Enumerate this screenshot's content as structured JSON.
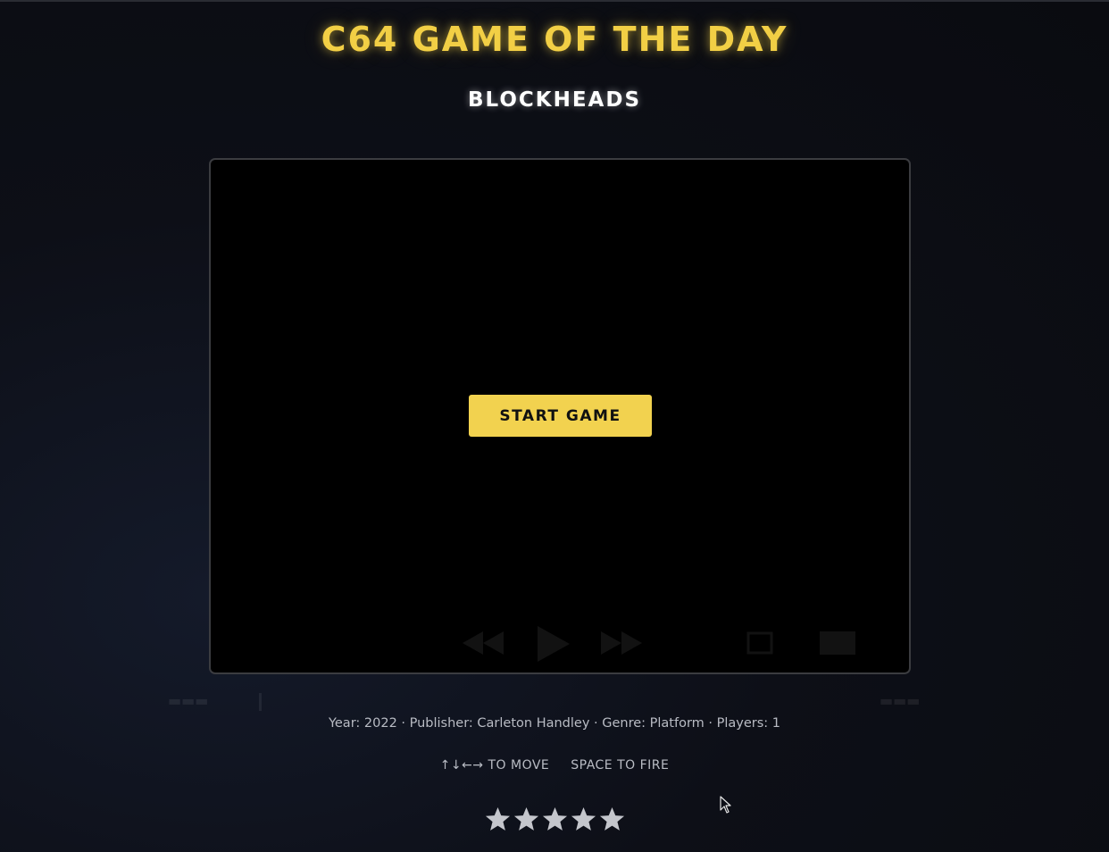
{
  "header": {
    "site_title": "C64 GAME OF THE DAY",
    "game_title": "BLOCKHEADS"
  },
  "player": {
    "start_label": "START GAME"
  },
  "details": {
    "meta_line": "Year: 2022 · Publisher: Carleton Handley · Genre: Platform · Players: 1"
  },
  "controls": {
    "move_hint": "↑↓←→ TO MOVE",
    "fire_hint": "SPACE TO FIRE"
  },
  "rating": {
    "stars": 5,
    "max": 5,
    "star_color": "#c4c6cc"
  },
  "colors": {
    "accent": "#f2cf45",
    "button": "#f2d24f",
    "background": "#0d0f17"
  }
}
